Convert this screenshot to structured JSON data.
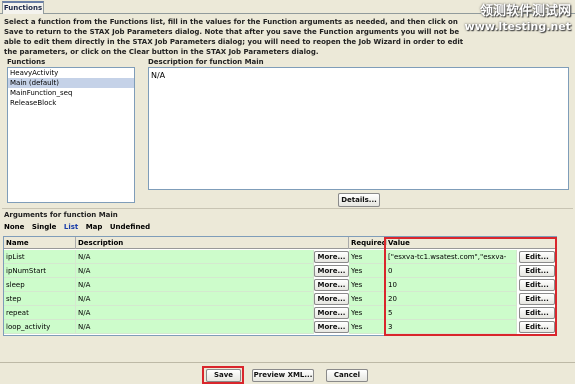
{
  "tabs": [
    {
      "label": "Functions"
    }
  ],
  "instructions": "Select a function from the Functions list, fill in the values for the Function arguments as needed, and then click on Save to return to the STAX Job Parameters dialog.  Note that after you save the Function arguments you will not be able to edit them directly in the STAX Job Parameters dialog; you will need to reopen the Job Wizard in order to edit the parameters, or click on the Clear button in the STAX Job Parameters dialog.",
  "watermark": {
    "line1": "领测软件测试网",
    "line2": "www.ltesting.net"
  },
  "functions": {
    "label": "Functions",
    "items": [
      {
        "label": "HeavyActivity"
      },
      {
        "label": "Main (default)"
      },
      {
        "label": "MainFunction_seq"
      },
      {
        "label": "ReleaseBlock"
      }
    ],
    "selected_index": 1
  },
  "description": {
    "label": "Description for function Main",
    "text": "N/A",
    "details_button": "Details..."
  },
  "arguments": {
    "label": "Arguments for function Main",
    "types": [
      "None",
      "Single",
      "List",
      "Map",
      "Undefined"
    ],
    "active_type": "List",
    "columns": {
      "name": "Name",
      "description": "Description",
      "required": "Required",
      "value": "Value"
    },
    "more_label": "More...",
    "edit_label": "Edit...",
    "rows": [
      {
        "name": "ipList",
        "description": "N/A",
        "required": "Yes",
        "value": "[\"esxva-tc1.wsatest.com\",\"esxva-"
      },
      {
        "name": "ipNumStart",
        "description": "N/A",
        "required": "Yes",
        "value": "0"
      },
      {
        "name": "sleep",
        "description": "N/A",
        "required": "Yes",
        "value": "10"
      },
      {
        "name": "step",
        "description": "N/A",
        "required": "Yes",
        "value": "20"
      },
      {
        "name": "repeat",
        "description": "N/A",
        "required": "Yes",
        "value": "5"
      },
      {
        "name": "loop_activity",
        "description": "N/A",
        "required": "Yes",
        "value": "3"
      }
    ]
  },
  "footer": {
    "save": "Save",
    "preview": "Preview XML...",
    "cancel": "Cancel"
  },
  "colors": {
    "highlight": "#d9262c",
    "row_green": "#cdfccb",
    "selection": "#c5d2e8"
  }
}
